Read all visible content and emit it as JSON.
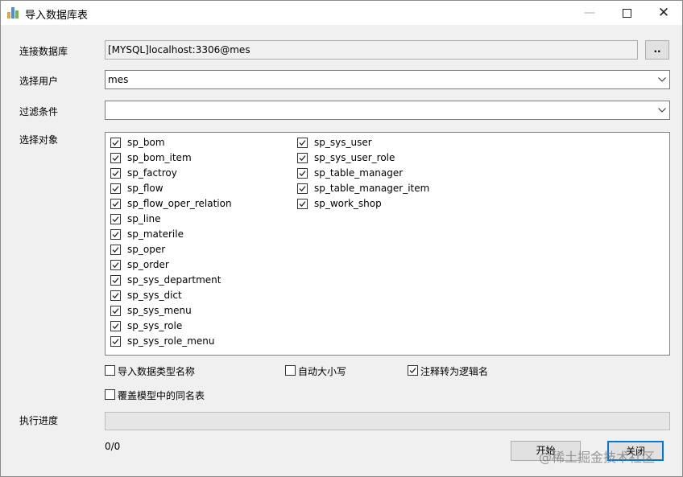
{
  "window": {
    "title": "导入数据库表",
    "controls": {
      "minimize": "—",
      "close": "✕"
    },
    "app_icon_colors": [
      "#e8a33a",
      "#4a8fd6",
      "#6bb64a"
    ]
  },
  "form": {
    "connection": {
      "label": "连接数据库",
      "value": "[MYSQL]localhost:3306@mes",
      "browse_label": ".."
    },
    "user": {
      "label": "选择用户",
      "value": "mes"
    },
    "filter": {
      "label": "过滤条件",
      "value": ""
    },
    "objects": {
      "label": "选择对象",
      "column1": [
        {
          "name": "sp_bom",
          "checked": true
        },
        {
          "name": "sp_bom_item",
          "checked": true
        },
        {
          "name": "sp_factroy",
          "checked": true
        },
        {
          "name": "sp_flow",
          "checked": true
        },
        {
          "name": "sp_flow_oper_relation",
          "checked": true
        },
        {
          "name": "sp_line",
          "checked": true
        },
        {
          "name": "sp_materile",
          "checked": true
        },
        {
          "name": "sp_oper",
          "checked": true
        },
        {
          "name": "sp_order",
          "checked": true
        },
        {
          "name": "sp_sys_department",
          "checked": true
        },
        {
          "name": "sp_sys_dict",
          "checked": true
        },
        {
          "name": "sp_sys_menu",
          "checked": true
        },
        {
          "name": "sp_sys_role",
          "checked": true
        },
        {
          "name": "sp_sys_role_menu",
          "checked": true
        }
      ],
      "column2": [
        {
          "name": "sp_sys_user",
          "checked": true
        },
        {
          "name": "sp_sys_user_role",
          "checked": true
        },
        {
          "name": "sp_table_manager",
          "checked": true
        },
        {
          "name": "sp_table_manager_item",
          "checked": true
        },
        {
          "name": "sp_work_shop",
          "checked": true
        }
      ]
    },
    "options": {
      "import_type_name": {
        "label": "导入数据类型名称",
        "checked": false
      },
      "auto_case": {
        "label": "自动大小写",
        "checked": false
      },
      "comment_to_logical": {
        "label": "注释转为逻辑名",
        "checked": true
      },
      "overwrite_same_name": {
        "label": "覆盖模型中的同名表",
        "checked": false
      }
    },
    "progress": {
      "label": "执行进度",
      "value": 0,
      "count_text": "0/0",
      "color": "#06b025"
    }
  },
  "buttons": {
    "start": "开始",
    "close": "关闭"
  },
  "watermark": "@稀土掘金技术社区"
}
